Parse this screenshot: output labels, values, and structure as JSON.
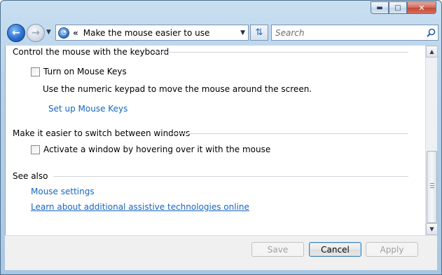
{
  "window": {
    "caption_buttons": {
      "minimize_icon": "minimize-icon",
      "maximize_icon": "maximize-icon",
      "close_icon": "close-icon"
    }
  },
  "navbar": {
    "back_glyph": "←",
    "forward_glyph": "→",
    "breadcrumb_chevron": "«",
    "address_text": "Make the mouse easier to use",
    "search_placeholder": "Search"
  },
  "content": {
    "section_keyboard": {
      "heading": "Control the mouse with the keyboard",
      "checkbox_label": "Turn on Mouse Keys",
      "checkbox_checked": false,
      "description": "Use the numeric keypad to move the mouse around the screen.",
      "link": "Set up Mouse Keys"
    },
    "section_windows": {
      "heading": "Make it easier to switch between windows",
      "checkbox_label": "Activate a window by hovering over it with the mouse",
      "checkbox_checked": false
    },
    "section_see_also": {
      "heading": "See also",
      "links": [
        "Mouse settings",
        "Learn about additional assistive technologies online"
      ]
    }
  },
  "footer": {
    "save_label": "Save",
    "cancel_label": "Cancel",
    "apply_label": "Apply"
  },
  "colors": {
    "link": "#1565c0",
    "chrome": "#b7d2ea"
  }
}
